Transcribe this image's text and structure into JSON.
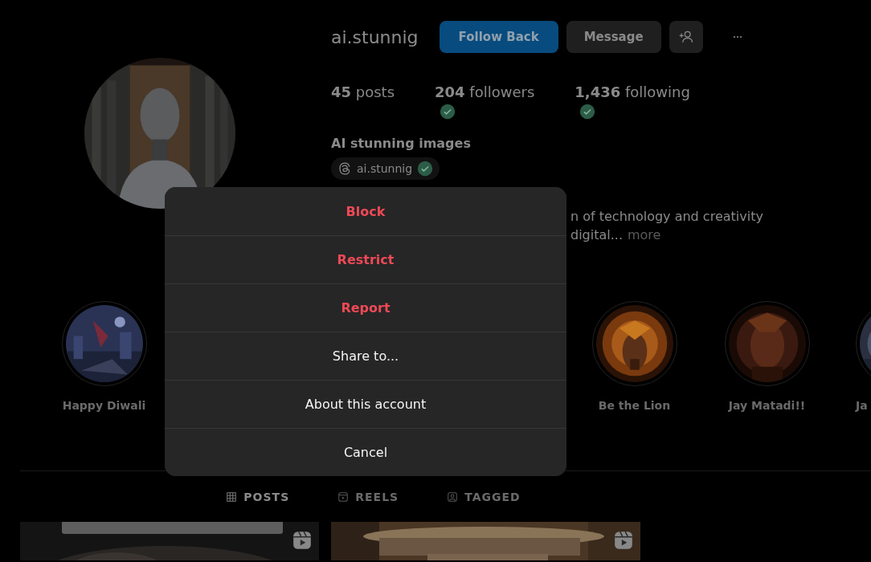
{
  "profile": {
    "username": "ai.stunnig",
    "buttons": [
      {
        "label": "Follow Back",
        "kind": "primary"
      },
      {
        "label": "Message",
        "kind": "secondary"
      }
    ],
    "stats": [
      {
        "count": "45",
        "label": "posts",
        "verified": false
      },
      {
        "count": "204",
        "label": "followers",
        "verified": true
      },
      {
        "count": "1,436",
        "label": "following",
        "verified": true
      }
    ],
    "display_name": "AI stunning images",
    "threads_badge": {
      "handle": "ai.stunnig",
      "verified": true
    },
    "bio_lines": [
      "n of technology and creativity",
      "digital..."
    ],
    "more_link": "more"
  },
  "highlights": [
    {
      "label": "Happy Diwali"
    },
    {
      "label": "Be the Lion"
    },
    {
      "label": "Jay Matadi!!"
    },
    {
      "label": "Ja"
    }
  ],
  "tabs": [
    {
      "label": "POSTS",
      "kind": "grid",
      "selected": true
    },
    {
      "label": "REELS",
      "kind": "reels",
      "selected": false
    },
    {
      "label": "TAGGED",
      "kind": "tagged",
      "selected": false
    }
  ],
  "posts": [
    {
      "kind": "reel"
    },
    {
      "kind": "reel"
    }
  ],
  "menu": {
    "items": [
      {
        "label": "Block",
        "kind": "danger"
      },
      {
        "label": "Restrict",
        "kind": "danger"
      },
      {
        "label": "Report",
        "kind": "danger"
      },
      {
        "label": "Share to...",
        "kind": "normal"
      },
      {
        "label": "About this account",
        "kind": "normal"
      },
      {
        "label": "Cancel",
        "kind": "normal"
      }
    ]
  }
}
